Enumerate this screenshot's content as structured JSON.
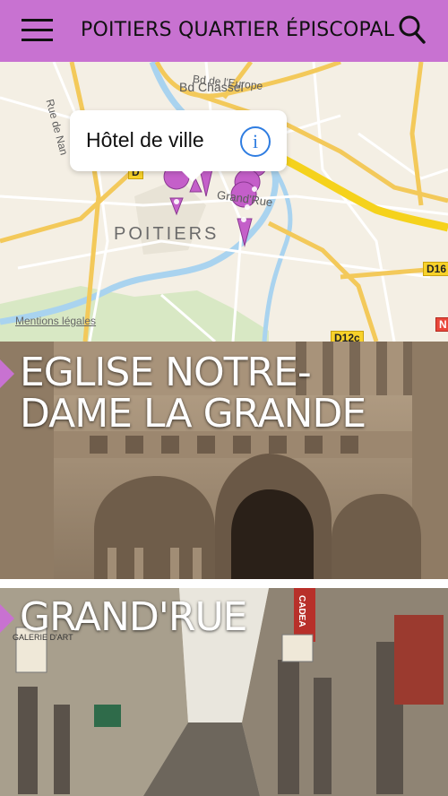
{
  "header": {
    "title": "POITIERS QUARTIER ÉPISCOPAL",
    "menu_icon": "menu-icon",
    "search_icon": "search-icon",
    "background": "#c872d1"
  },
  "map": {
    "callout_label": "Hôtel de ville",
    "info_symbol": "i",
    "legal_text": "Mentions légales",
    "city_label": "POITIERS",
    "street_labels": {
      "bd_europe": "Bd de l'Europe",
      "bd_chasseigne": "Bd Chassei",
      "grand_rue": "Grand'Rue",
      "rue_nan": "Rue de Nan"
    },
    "road_badges": {
      "d16": "D16",
      "d12c": "D12c",
      "n": "N",
      "d_left": "D"
    },
    "pin_color": "#c45fc9"
  },
  "cards": {
    "notre_dame": {
      "title_line1": "EGLISE NOTRE-",
      "title_line2": "DAME LA GRANDE"
    },
    "grand_rue": {
      "title": "GRAND'RUE",
      "sign_galerie": "GALERIE D'ART",
      "sign_cadeaux": "CADEA"
    }
  }
}
